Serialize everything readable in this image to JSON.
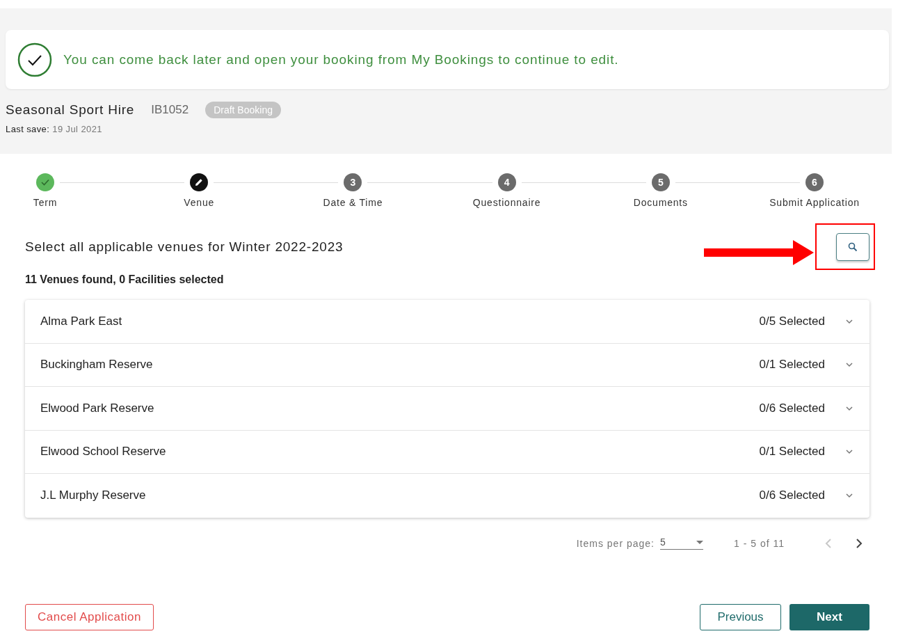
{
  "banner": {
    "message": "You can come back later and open your booking from My Bookings to continue to edit."
  },
  "header": {
    "title": "Seasonal Sport Hire",
    "reference": "IB1052",
    "status_badge": "Draft Booking",
    "last_save_label": "Last save:",
    "last_save_date": "19 Jul 2021"
  },
  "steps": [
    {
      "label": "Term",
      "kind": "done"
    },
    {
      "label": "Venue",
      "kind": "current"
    },
    {
      "label": "Date & Time",
      "kind": "pending",
      "number": "3"
    },
    {
      "label": "Questionnaire",
      "kind": "pending",
      "number": "4"
    },
    {
      "label": "Documents",
      "kind": "pending",
      "number": "5"
    },
    {
      "label": "Submit Application",
      "kind": "pending",
      "number": "6"
    }
  ],
  "heading": "Select all applicable venues for Winter 2022-2023",
  "summary": "11 Venues found, 0 Facilities selected",
  "venues": [
    {
      "name": "Alma Park East",
      "count": "0/5 Selected",
      "expanded": false
    },
    {
      "name": "Buckingham Reserve",
      "count": "0/1 Selected",
      "expanded": false
    },
    {
      "name": "Elwood Park Reserve",
      "count": "0/6 Selected",
      "expanded": false
    },
    {
      "name": "Elwood School Reserve",
      "count": "0/1 Selected",
      "expanded": false
    },
    {
      "name": "J.L Murphy Reserve",
      "count": "0/6 Selected",
      "expanded": false
    }
  ],
  "paginator": {
    "items_per_page_label": "Items per page:",
    "page_size": "5",
    "range": "1 - 5 of 11",
    "previous_disabled": true,
    "next_disabled": false
  },
  "buttons": {
    "cancel": "Cancel Application",
    "previous": "Previous",
    "next": "Next"
  }
}
